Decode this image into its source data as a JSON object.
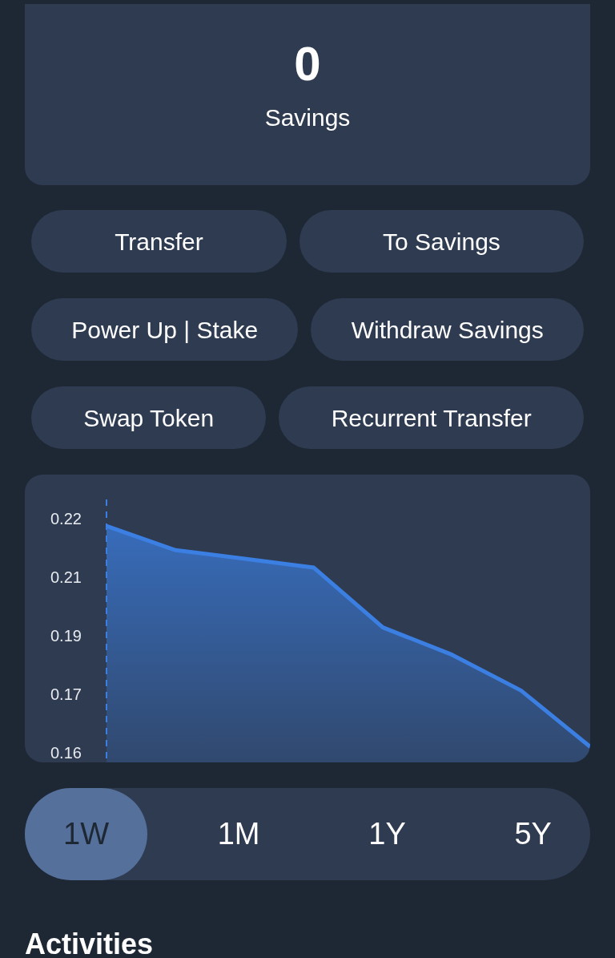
{
  "balance": {
    "value": "0",
    "label": "Savings"
  },
  "action_rows": [
    [
      {
        "label": "Transfer"
      },
      {
        "label": "To Savings"
      }
    ],
    [
      {
        "label": "Power Up | Stake"
      },
      {
        "label": "Withdraw Savings"
      }
    ],
    [
      {
        "label": "Swap Token"
      },
      {
        "label": "Recurrent Transfer"
      }
    ]
  ],
  "chart": {
    "chart_data": {
      "type": "area",
      "categories": [
        null,
        null,
        null,
        null,
        null,
        null,
        null,
        null
      ],
      "series": [
        {
          "color": "#3b7fe3",
          "values": [
            0.2182,
            0.212,
            0.2098,
            0.2075,
            0.1922,
            0.1852,
            0.176,
            0.1616
          ]
        }
      ],
      "ylim": [
        0.158,
        0.225
      ],
      "yticks": [
        {
          "value": 0.16,
          "label": "0.16"
        },
        {
          "value": 0.175,
          "label": "0.17"
        },
        {
          "value": 0.19,
          "label": "0.19"
        },
        {
          "value": 0.205,
          "label": "0.21"
        },
        {
          "value": 0.22,
          "label": "0.22"
        }
      ]
    }
  },
  "time_ranges": [
    {
      "label": "1W",
      "selected": true
    },
    {
      "label": "1M",
      "selected": false
    },
    {
      "label": "1Y",
      "selected": false
    },
    {
      "label": "5Y",
      "selected": false
    }
  ],
  "section_title": "Activities"
}
